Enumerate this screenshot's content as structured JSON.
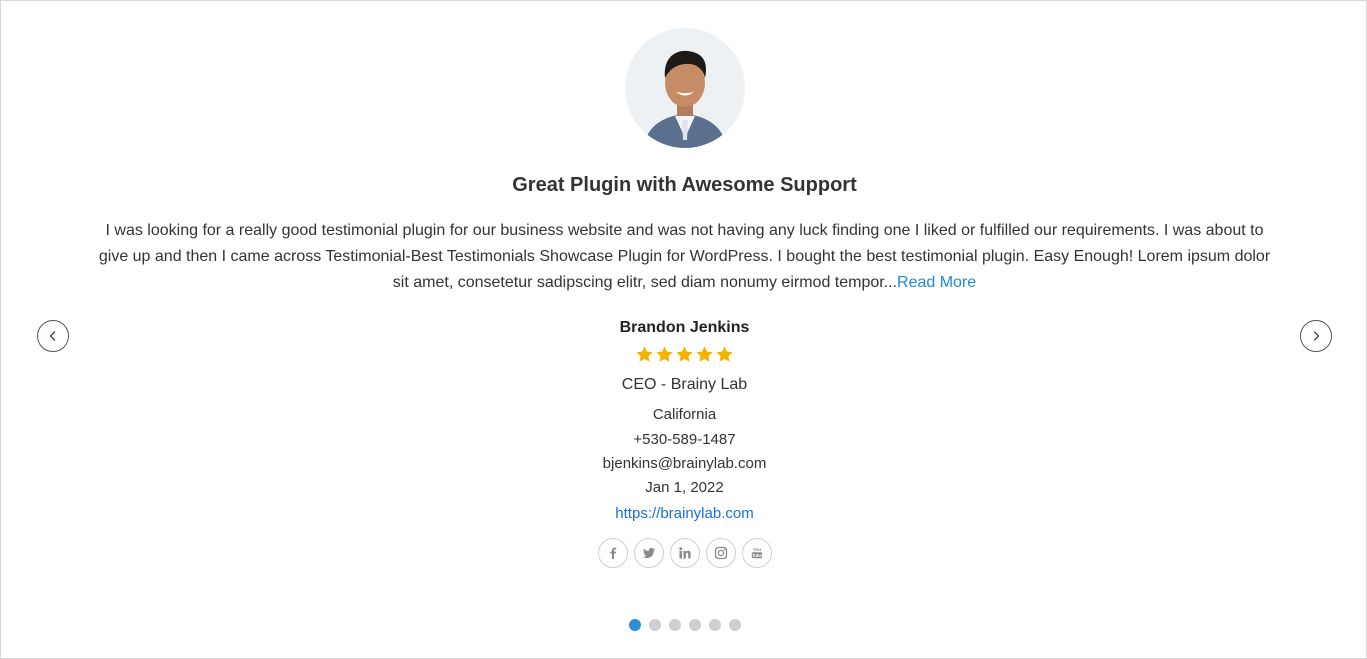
{
  "testimonial": {
    "title": "Great Plugin with Awesome Support",
    "body": "I was looking for a really good testimonial plugin for our business website and was not having any luck finding one I liked or fulfilled our requirements. I was about to give up and then I came across Testimonial-Best Testimonials Showcase Plugin for WordPress. I bought the best testimonial plugin. Easy Enough! Lorem ipsum dolor sit amet, consetetur sadipscing elitr, sed diam nonumy eirmod tempor...",
    "read_more_label": "Read More",
    "name": "Brandon Jenkins",
    "rating": 5,
    "rating_max": 5,
    "role": "CEO - Brainy Lab",
    "location": "California",
    "phone": "+530-589-1487",
    "email": "bjenkins@brainylab.com",
    "date": "Jan 1, 2022",
    "website": "https://brainylab.com"
  },
  "socials": [
    "facebook-icon",
    "twitter-icon",
    "linkedin-icon",
    "instagram-icon",
    "youtube-icon"
  ],
  "navigation": {
    "prev_icon": "chevron-left-icon",
    "next_icon": "chevron-right-icon"
  },
  "pagination": {
    "total": 6,
    "active_index": 0
  },
  "colors": {
    "star": "#f5b301",
    "link": "#1a8cd8",
    "dot_active": "#2d8fd6",
    "dot_inactive": "#cfcfcf"
  }
}
